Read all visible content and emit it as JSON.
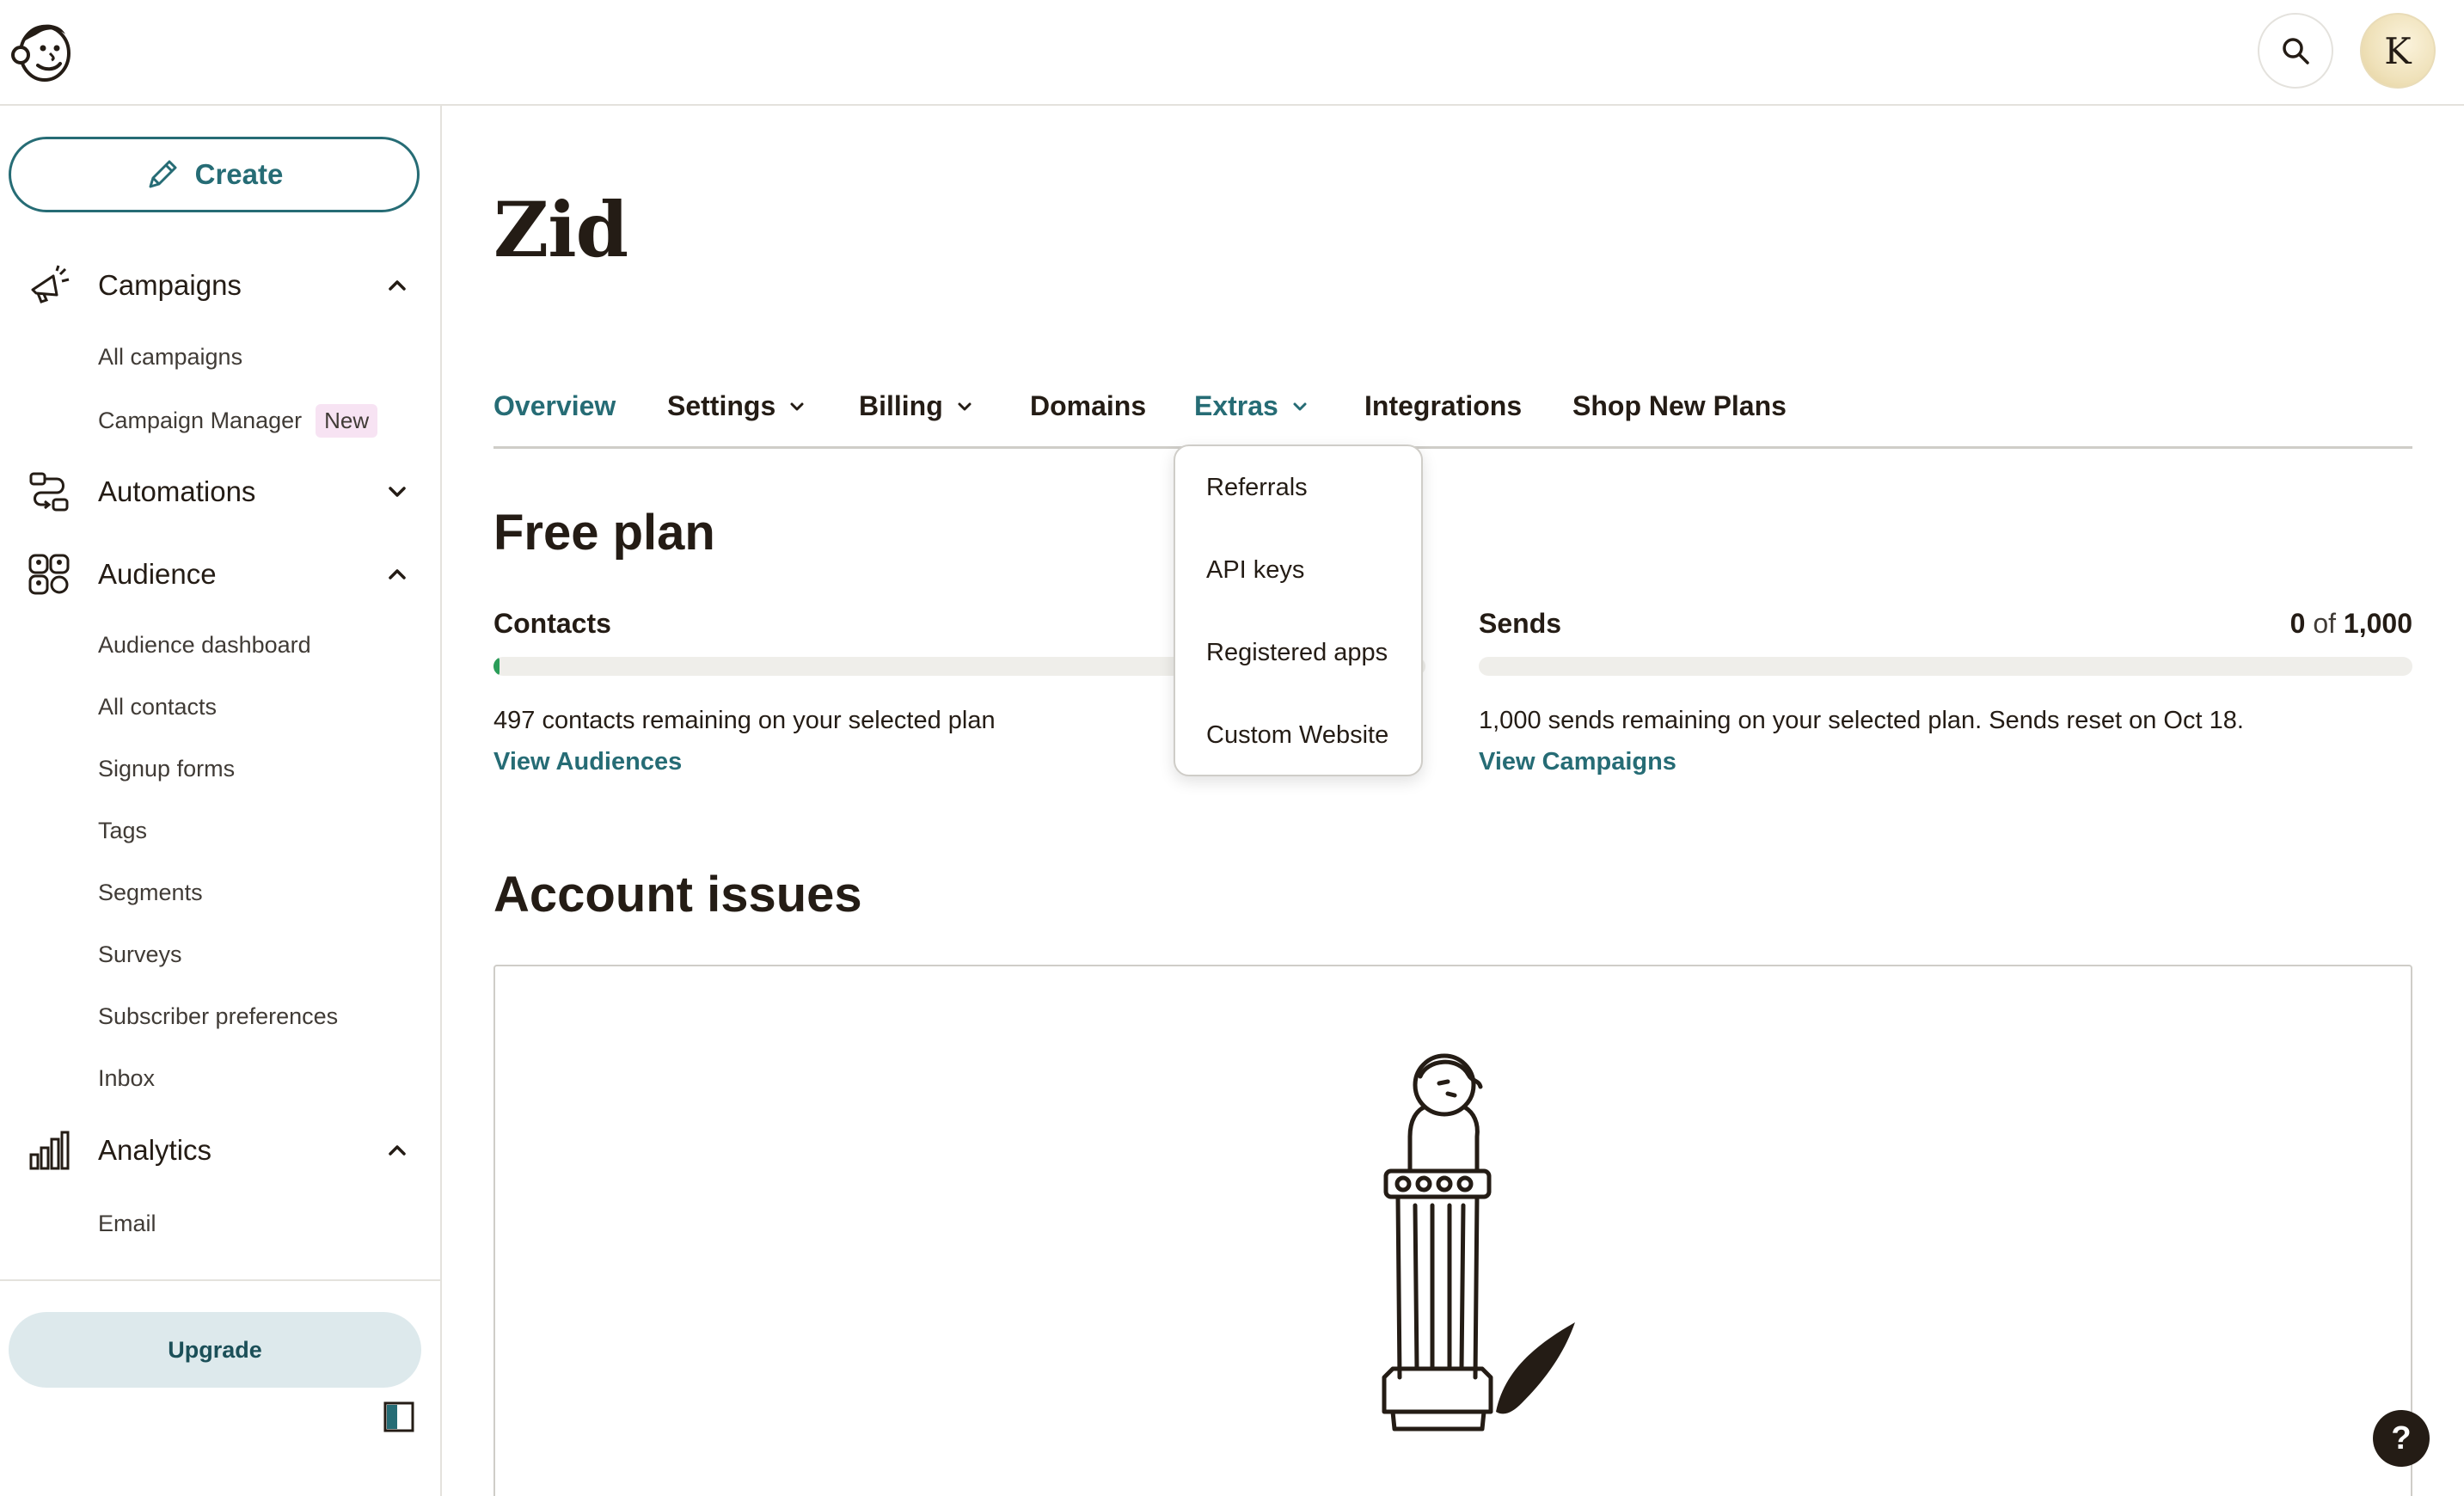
{
  "app": {
    "logo": "mailchimp-freddie-logo",
    "avatar_initial": "K"
  },
  "sidebar": {
    "create_label": "Create",
    "sections": {
      "campaigns": {
        "label": "Campaigns",
        "items": [
          "All campaigns",
          "Campaign Manager"
        ],
        "campaign_manager_badge": "New"
      },
      "automations": {
        "label": "Automations"
      },
      "audience": {
        "label": "Audience",
        "items": [
          "Audience dashboard",
          "All contacts",
          "Signup forms",
          "Tags",
          "Segments",
          "Surveys",
          "Subscriber preferences",
          "Inbox"
        ]
      },
      "analytics": {
        "label": "Analytics",
        "items": [
          "Email"
        ]
      }
    },
    "upgrade_label": "Upgrade"
  },
  "main": {
    "title": "Zid",
    "tabs": [
      "Overview",
      "Settings",
      "Billing",
      "Domains",
      "Extras",
      "Integrations",
      "Shop New Plans"
    ],
    "active_tab": "Overview",
    "open_dropdown": "Extras",
    "extras_menu": [
      "Referrals",
      "API keys",
      "Registered apps",
      "Custom Website"
    ],
    "plan_title": "Free plan",
    "contacts": {
      "label": "Contacts",
      "used_fraction": 0.006,
      "remaining_text": "497 contacts remaining on your selected plan",
      "link": "View Audiences"
    },
    "sends": {
      "label": "Sends",
      "used": "0",
      "of": "of",
      "limit": "1,000",
      "used_fraction": 0,
      "remaining_text": "1,000 sends remaining on your selected plan. Sends reset on Oct 18.",
      "link": "View Campaigns"
    },
    "issues_title": "Account issues"
  },
  "help_label": "?",
  "colors": {
    "accent": "#266c75",
    "progress": "#2a9d59",
    "badge_bg": "#f7e3f3",
    "upgrade_bg": "#dde9ec"
  }
}
